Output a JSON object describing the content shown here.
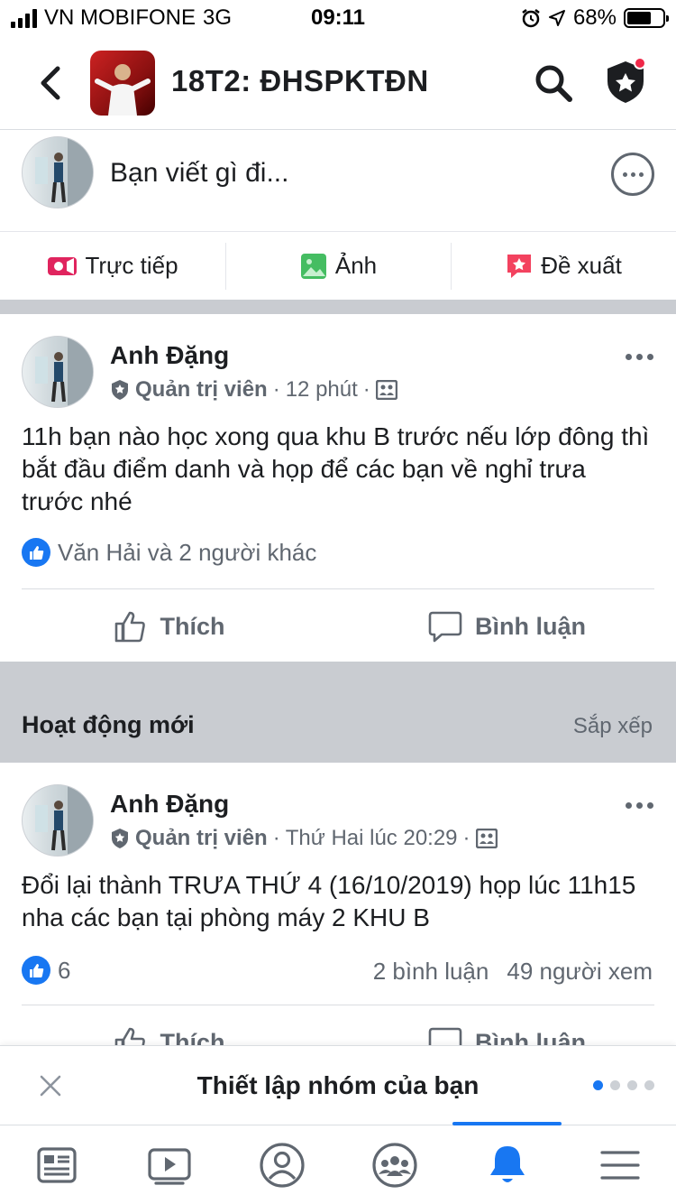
{
  "status_bar": {
    "carrier": "VN MOBIFONE",
    "network": "3G",
    "time": "09:11",
    "battery": "68%",
    "battery_level": 0.68
  },
  "header": {
    "group_name": "18T2: ĐHSPKTĐN",
    "icons": [
      "back-icon",
      "search-icon",
      "admin-shield-icon"
    ]
  },
  "composer": {
    "placeholder": "Bạn viết gì đi..."
  },
  "composer_actions": [
    {
      "label": "Trực tiếp",
      "icon": "live-video-icon",
      "color": "#e0245e"
    },
    {
      "label": "Ảnh",
      "icon": "photo-icon",
      "color": "#45bd62"
    },
    {
      "label": "Đề xuất",
      "icon": "recommend-icon",
      "color": "#f3425f"
    }
  ],
  "pinned_post": {
    "author": "Anh Đặng",
    "role": "Quản trị viên",
    "time": "12 phút",
    "text": "11h bạn nào học xong qua khu B trước nếu lớp đông thì bắt đầu điểm danh và họp để các bạn về nghỉ trưa trước nhé",
    "reactions": "Văn Hải và 2 người khác",
    "like_label": "Thích",
    "comment_label": "Bình luận"
  },
  "section": {
    "title": "Hoạt động mới",
    "sort_label": "Sắp xếp"
  },
  "recent_post": {
    "author": "Anh Đặng",
    "role": "Quản trị viên",
    "time": "Thứ Hai lúc 20:29",
    "text": "Đổi lại thành TRƯA THỨ 4 (16/10/2019) họp lúc 11h15 nha các bạn tại phòng máy 2 KHU B",
    "reaction_count": "6",
    "comments": "2 bình luận",
    "views": "49 người xem",
    "like_label": "Thích",
    "comment_label": "Bình luận"
  },
  "banner": {
    "title": "Thiết lập nhóm của bạn",
    "page_count": 4,
    "active_page": 1
  },
  "tabbar": {
    "tabs": [
      "news-feed-icon",
      "watch-icon",
      "profile-icon",
      "groups-icon",
      "notifications-icon",
      "menu-icon"
    ],
    "active": "notifications-icon",
    "accent": "#1877f2"
  }
}
